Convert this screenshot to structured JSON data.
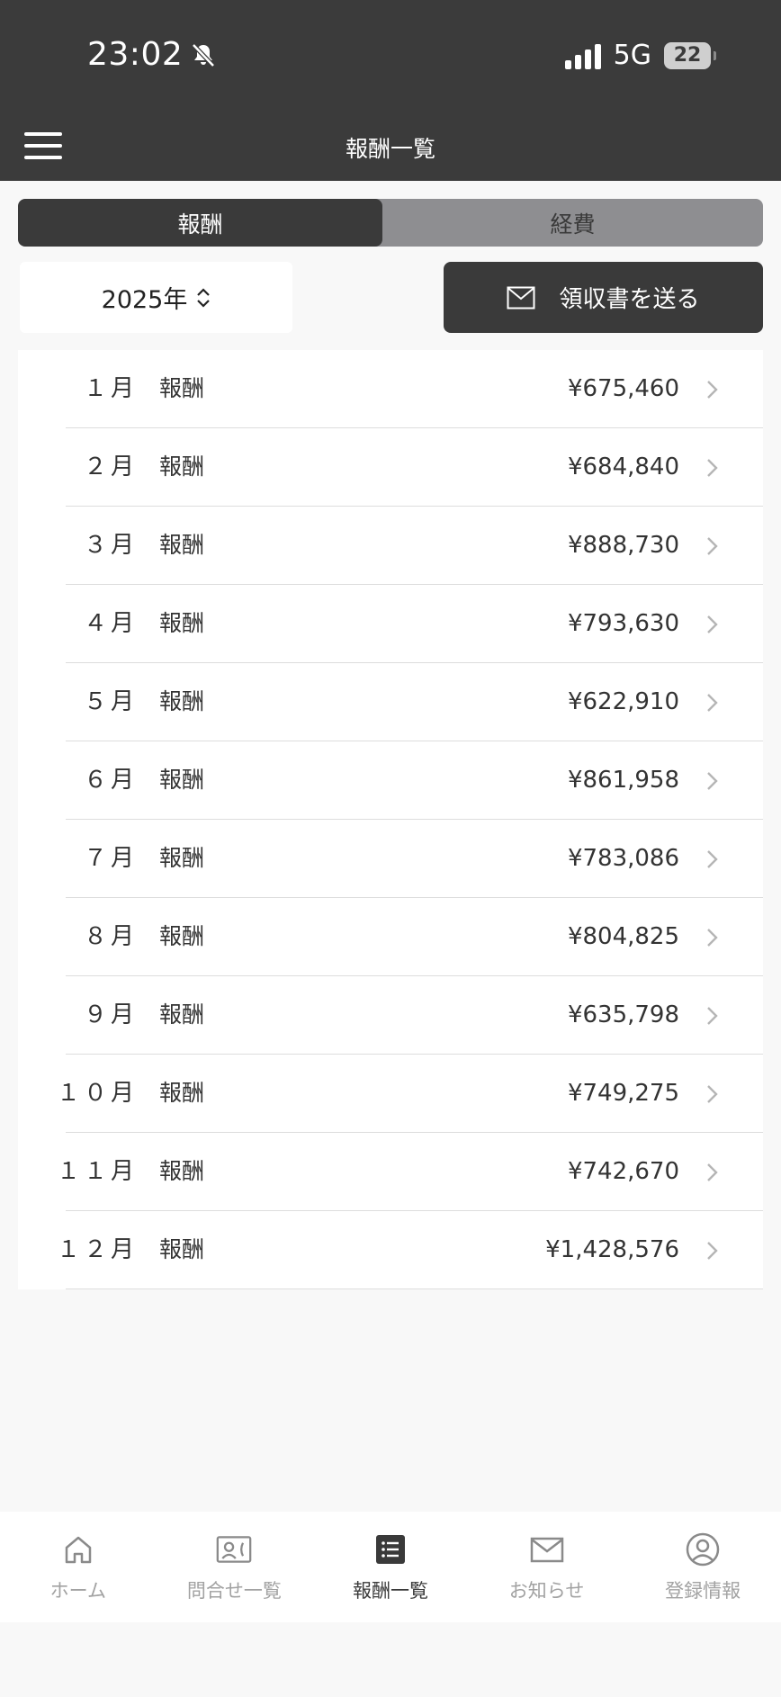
{
  "status_bar": {
    "time": "23:02",
    "network": "5G",
    "battery": "22"
  },
  "header": {
    "title": "報酬一覧"
  },
  "segments": {
    "active": "報酬",
    "inactive": "経費"
  },
  "year_selector": {
    "value": "2025年"
  },
  "send_button": {
    "label": "領収書を送る"
  },
  "rows": [
    {
      "month": "１月",
      "label": "報酬",
      "amount": "¥675,460"
    },
    {
      "month": "２月",
      "label": "報酬",
      "amount": "¥684,840"
    },
    {
      "month": "３月",
      "label": "報酬",
      "amount": "¥888,730"
    },
    {
      "month": "４月",
      "label": "報酬",
      "amount": "¥793,630"
    },
    {
      "month": "５月",
      "label": "報酬",
      "amount": "¥622,910"
    },
    {
      "month": "６月",
      "label": "報酬",
      "amount": "¥861,958"
    },
    {
      "month": "７月",
      "label": "報酬",
      "amount": "¥783,086"
    },
    {
      "month": "８月",
      "label": "報酬",
      "amount": "¥804,825"
    },
    {
      "month": "９月",
      "label": "報酬",
      "amount": "¥635,798"
    },
    {
      "month": "１０月",
      "label": "報酬",
      "amount": "¥749,275"
    },
    {
      "month": "１１月",
      "label": "報酬",
      "amount": "¥742,670"
    },
    {
      "month": "１２月",
      "label": "報酬",
      "amount": "¥1,428,576"
    }
  ],
  "tabbar": {
    "items": [
      {
        "label": "ホーム",
        "icon": "home-icon"
      },
      {
        "label": "問合せ一覧",
        "icon": "contact-card-icon"
      },
      {
        "label": "報酬一覧",
        "icon": "list-icon",
        "active": true
      },
      {
        "label": "お知らせ",
        "icon": "mail-icon"
      },
      {
        "label": "登録情報",
        "icon": "user-circle-icon"
      }
    ]
  },
  "colors": {
    "header_bg": "#3b3b3b",
    "segment_inactive_bg": "#8e8e91",
    "page_bg": "#f8f8f8",
    "tab_inactive": "#a2a2a2"
  }
}
